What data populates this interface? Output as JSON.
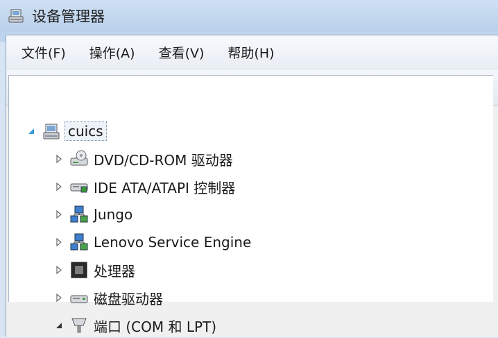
{
  "window": {
    "title": "设备管理器"
  },
  "menu": [
    {
      "label": "文件(F)"
    },
    {
      "label": "操作(A)"
    },
    {
      "label": "查看(V)"
    },
    {
      "label": "帮助(H)"
    }
  ],
  "toolbar": {
    "buttons": [
      "back-icon",
      "forward-icon",
      "show-hide-tree-icon",
      "help-icon",
      "properties-icon",
      "scan-hardware-icon"
    ]
  },
  "tree": {
    "root": {
      "label": "cuics",
      "expanded": true
    },
    "items": [
      {
        "label": "DVD/CD-ROM 驱动器",
        "icon": "dvd-drive-icon",
        "expanded": false
      },
      {
        "label": "IDE ATA/ATAPI 控制器",
        "icon": "ide-controller-icon",
        "expanded": false
      },
      {
        "label": "Jungo",
        "icon": "network-device-icon",
        "expanded": false
      },
      {
        "label": "Lenovo Service Engine",
        "icon": "network-device-icon",
        "expanded": false
      },
      {
        "label": "处理器",
        "icon": "processor-icon",
        "expanded": false
      },
      {
        "label": "磁盘驱动器",
        "icon": "disk-drive-icon",
        "expanded": false
      },
      {
        "label": "端口 (COM 和 LPT)",
        "icon": "port-icon",
        "expanded": true
      }
    ]
  }
}
